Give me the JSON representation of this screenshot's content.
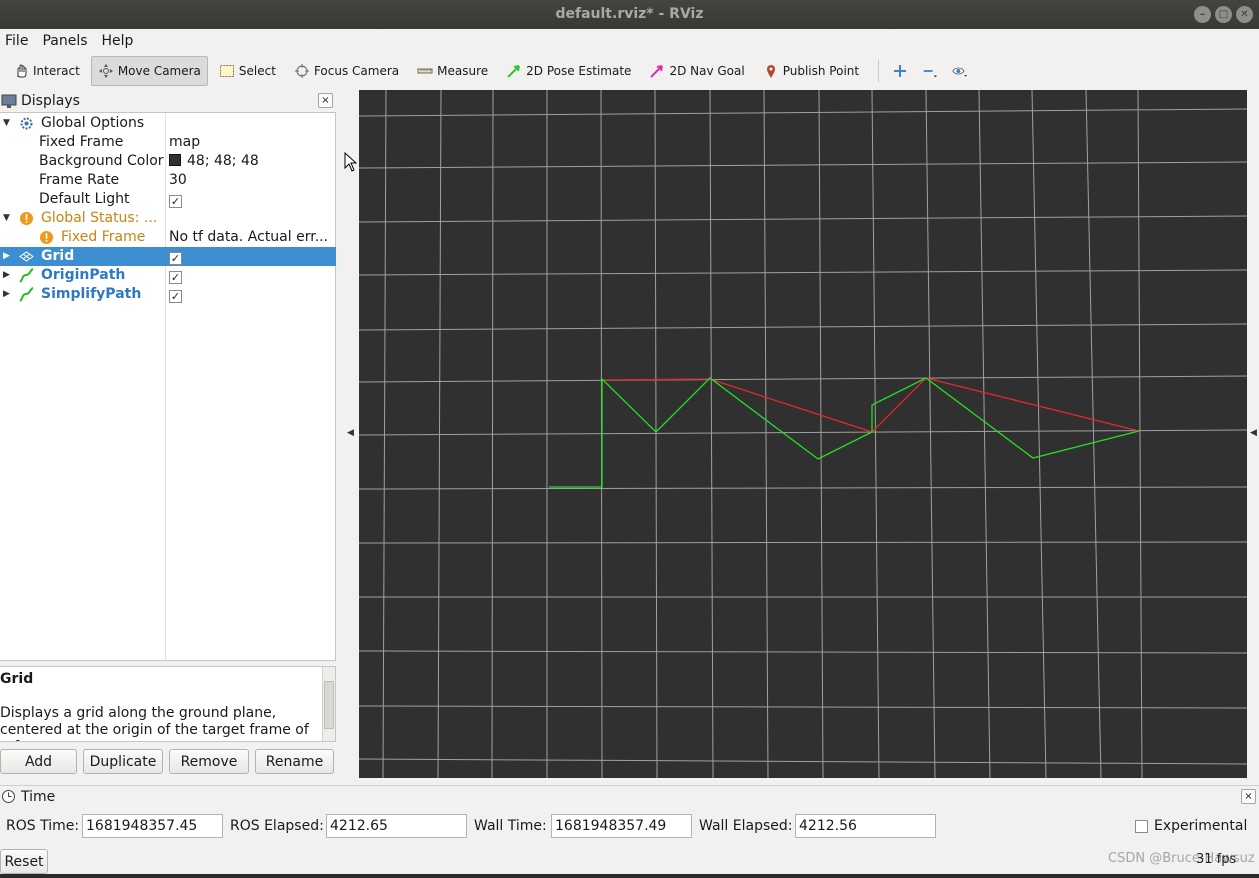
{
  "window": {
    "title": "default.rviz* - RViz",
    "controls": [
      "–",
      "□",
      "✕"
    ]
  },
  "menu": {
    "file": "File",
    "panels": "Panels",
    "help": "Help"
  },
  "toolbar": {
    "interact": "Interact",
    "move_camera": "Move Camera",
    "select": "Select",
    "focus_camera": "Focus Camera",
    "measure": "Measure",
    "pose_estimate": "2D Pose Estimate",
    "nav_goal": "2D Nav Goal",
    "publish_point": "Publish Point"
  },
  "displays": {
    "title": "Displays",
    "close": "×",
    "global_options": {
      "label": "Global Options",
      "fixed_frame_label": "Fixed Frame",
      "fixed_frame_value": "map",
      "background_color_label": "Background Color",
      "background_color_value": "48; 48; 48",
      "frame_rate_label": "Frame Rate",
      "frame_rate_value": "30",
      "default_light_label": "Default Light",
      "default_light_checked": "✓"
    },
    "global_status": {
      "label": "Global Status: ...",
      "fixed_frame_label": "Fixed Frame",
      "fixed_frame_value": "No tf data.  Actual err..."
    },
    "items": [
      {
        "label": "Grid",
        "checked": "✓"
      },
      {
        "label": "OriginPath",
        "checked": "✓"
      },
      {
        "label": "SimplifyPath",
        "checked": "✓"
      }
    ]
  },
  "description": {
    "title": "Grid",
    "text": "Displays a grid along the ground plane, centered at the origin of the target frame of reference."
  },
  "buttons": {
    "add": "Add",
    "duplicate": "Duplicate",
    "remove": "Remove",
    "rename": "Rename"
  },
  "time": {
    "title": "Time",
    "close": "×",
    "ros_time_label": "ROS Time:",
    "ros_time": "1681948357.45",
    "ros_elapsed_label": "ROS Elapsed:",
    "ros_elapsed": "4212.65",
    "wall_time_label": "Wall Time:",
    "wall_time": "1681948357.49",
    "wall_elapsed_label": "Wall Elapsed:",
    "wall_elapsed": "4212.56",
    "experimental_label": "Experimental",
    "reset": "Reset",
    "fps": "31 fps"
  },
  "watermark": "CSDN @Bruce-Hawsuz",
  "colors": {
    "background": "#303030",
    "grid": "#a0a0a0",
    "origin_path": "#22e022",
    "simplify_path": "#e02a2a",
    "selection": "#3d8fd1"
  }
}
